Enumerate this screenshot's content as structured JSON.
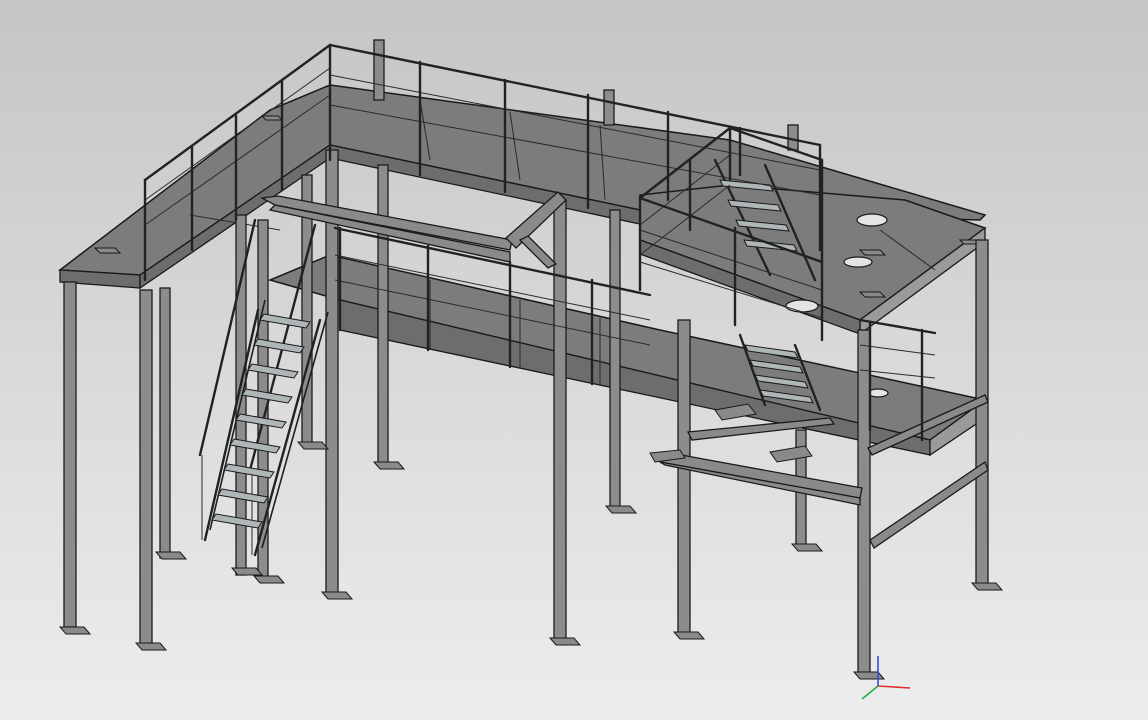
{
  "scene": {
    "background_top": "#c5c5c5",
    "background_bottom": "#ededed",
    "model_color": "#808080",
    "edge_color": "#1a1a1a"
  },
  "triad": {
    "x_axis_color": "#e03030",
    "y_axis_color": "#20b040",
    "z_axis_color": "#3050e0"
  }
}
